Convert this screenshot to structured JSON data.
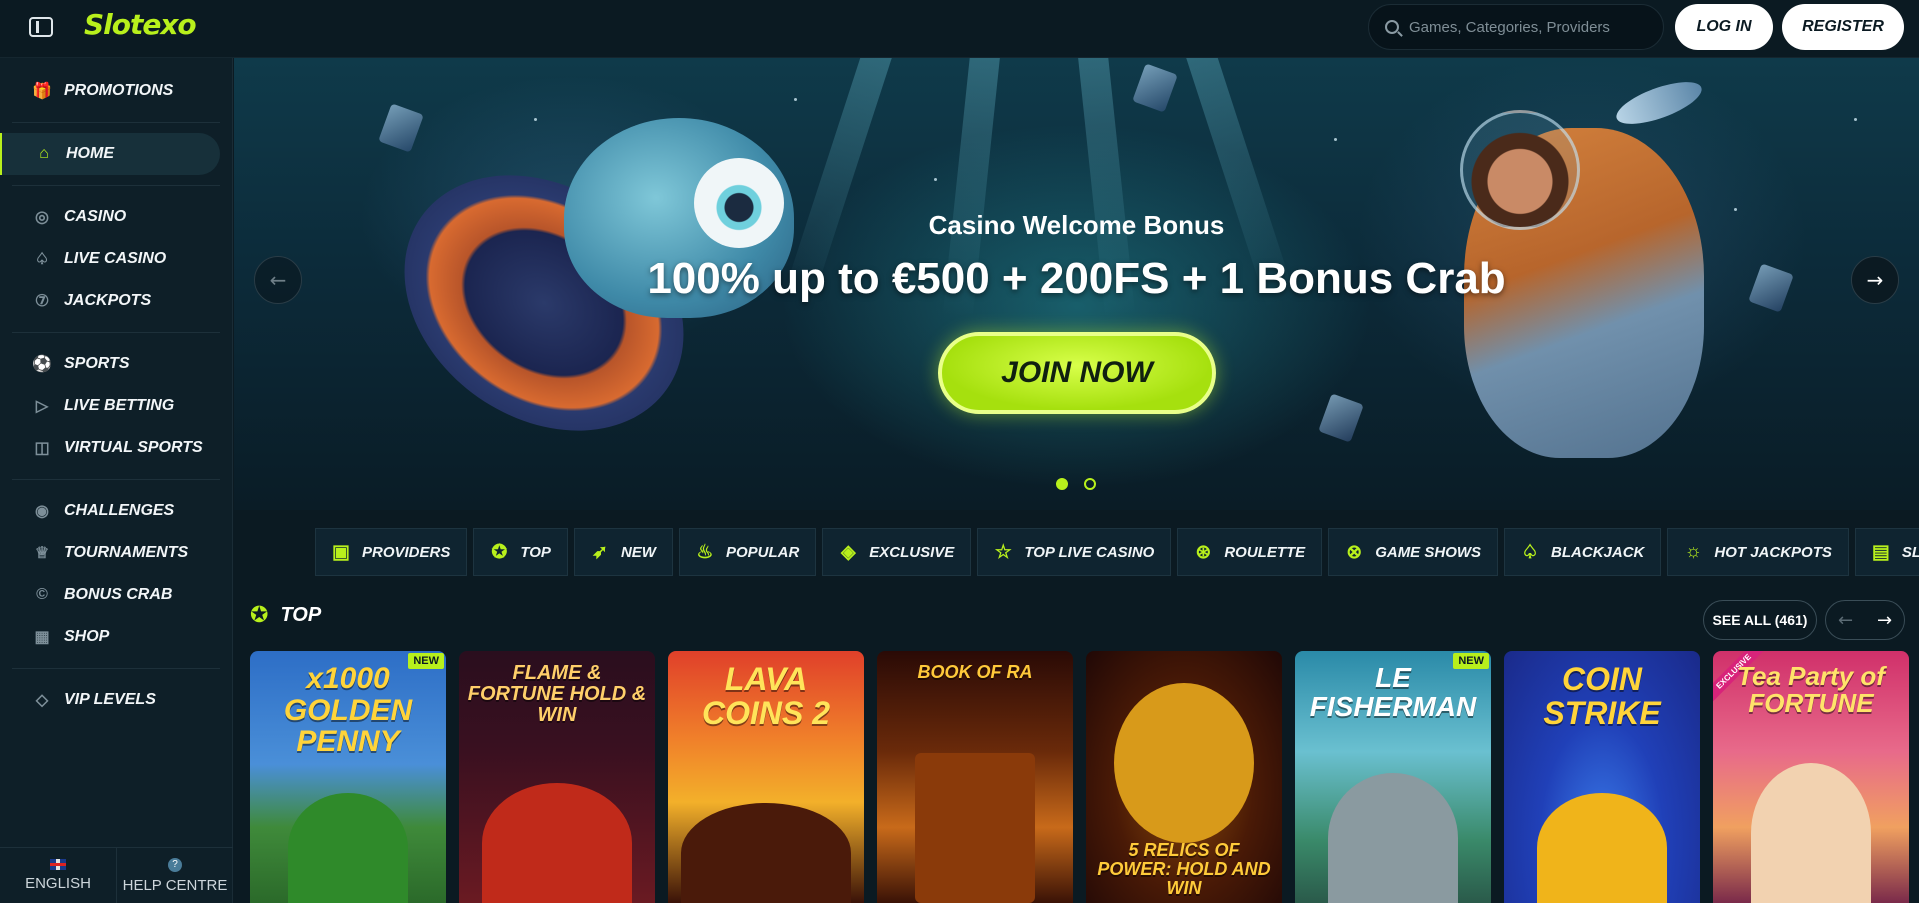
{
  "header": {
    "logo": "Slotexo",
    "search_placeholder": "Games, Categories, Providers",
    "login_label": "LOG IN",
    "register_label": "REGISTER"
  },
  "sidebar": {
    "groups": [
      [
        {
          "label": "PROMOTIONS",
          "icon": "gift-icon"
        }
      ],
      [
        {
          "label": "HOME",
          "icon": "home-icon",
          "active": true
        }
      ],
      [
        {
          "label": "CASINO",
          "icon": "chip-icon"
        },
        {
          "label": "LIVE CASINO",
          "icon": "spade-icon"
        },
        {
          "label": "JACKPOTS",
          "icon": "seven-icon"
        }
      ],
      [
        {
          "label": "SPORTS",
          "icon": "soccer-ball-icon"
        },
        {
          "label": "LIVE BETTING",
          "icon": "play-icon"
        },
        {
          "label": "VIRTUAL SPORTS",
          "icon": "gamepad-icon"
        }
      ],
      [
        {
          "label": "CHALLENGES",
          "icon": "target-icon"
        },
        {
          "label": "TOURNAMENTS",
          "icon": "trophy-icon"
        },
        {
          "label": "BONUS CRAB",
          "icon": "crab-icon"
        },
        {
          "label": "SHOP",
          "icon": "shop-icon"
        }
      ],
      [
        {
          "label": "VIP LEVELS",
          "icon": "diamond-icon"
        }
      ]
    ],
    "footer": {
      "language": "ENGLISH",
      "help": "HELP CENTRE"
    }
  },
  "hero": {
    "subtitle": "Casino Welcome Bonus",
    "title": "100% up to €500 + 200FS + 1 Bonus Crab",
    "cta": "JOIN NOW",
    "slides": 2,
    "active_slide": 1
  },
  "categories": [
    {
      "label": "PROVIDERS",
      "icon": "grid-icon"
    },
    {
      "label": "TOP",
      "icon": "medal-icon"
    },
    {
      "label": "NEW",
      "icon": "rocket-icon"
    },
    {
      "label": "POPULAR",
      "icon": "flame-icon"
    },
    {
      "label": "EXCLUSIVE",
      "icon": "diamond-icon"
    },
    {
      "label": "TOP LIVE CASINO",
      "icon": "star-icon"
    },
    {
      "label": "ROULETTE",
      "icon": "roulette-icon"
    },
    {
      "label": "GAME SHOWS",
      "icon": "wheel-icon"
    },
    {
      "label": "BLACKJACK",
      "icon": "spade-icon"
    },
    {
      "label": "HOT JACKPOTS",
      "icon": "hot-icon"
    },
    {
      "label": "SLOTS",
      "icon": "slot-machine-icon"
    }
  ],
  "top_section": {
    "title": "TOP",
    "see_all": "SEE ALL (461)",
    "games": [
      {
        "title": "x1000 GOLDEN PENNY",
        "badge": "NEW"
      },
      {
        "title": "FLAME & FORTUNE HOLD & WIN",
        "badge": ""
      },
      {
        "title": "LAVA COINS 2",
        "badge": ""
      },
      {
        "title": "BOOK OF RA",
        "badge": ""
      },
      {
        "title": "5 RELICS OF POWER: HOLD AND WIN",
        "badge": ""
      },
      {
        "title": "LE FISHERMAN",
        "badge": "NEW"
      },
      {
        "title": "COIN STRIKE",
        "badge": ""
      },
      {
        "title": "Tea Party of FORTUNE",
        "badge": "",
        "ribbon": "EXCLUSIVE"
      }
    ]
  },
  "colors": {
    "accent": "#b8f01c",
    "background": "#0b1a22"
  }
}
